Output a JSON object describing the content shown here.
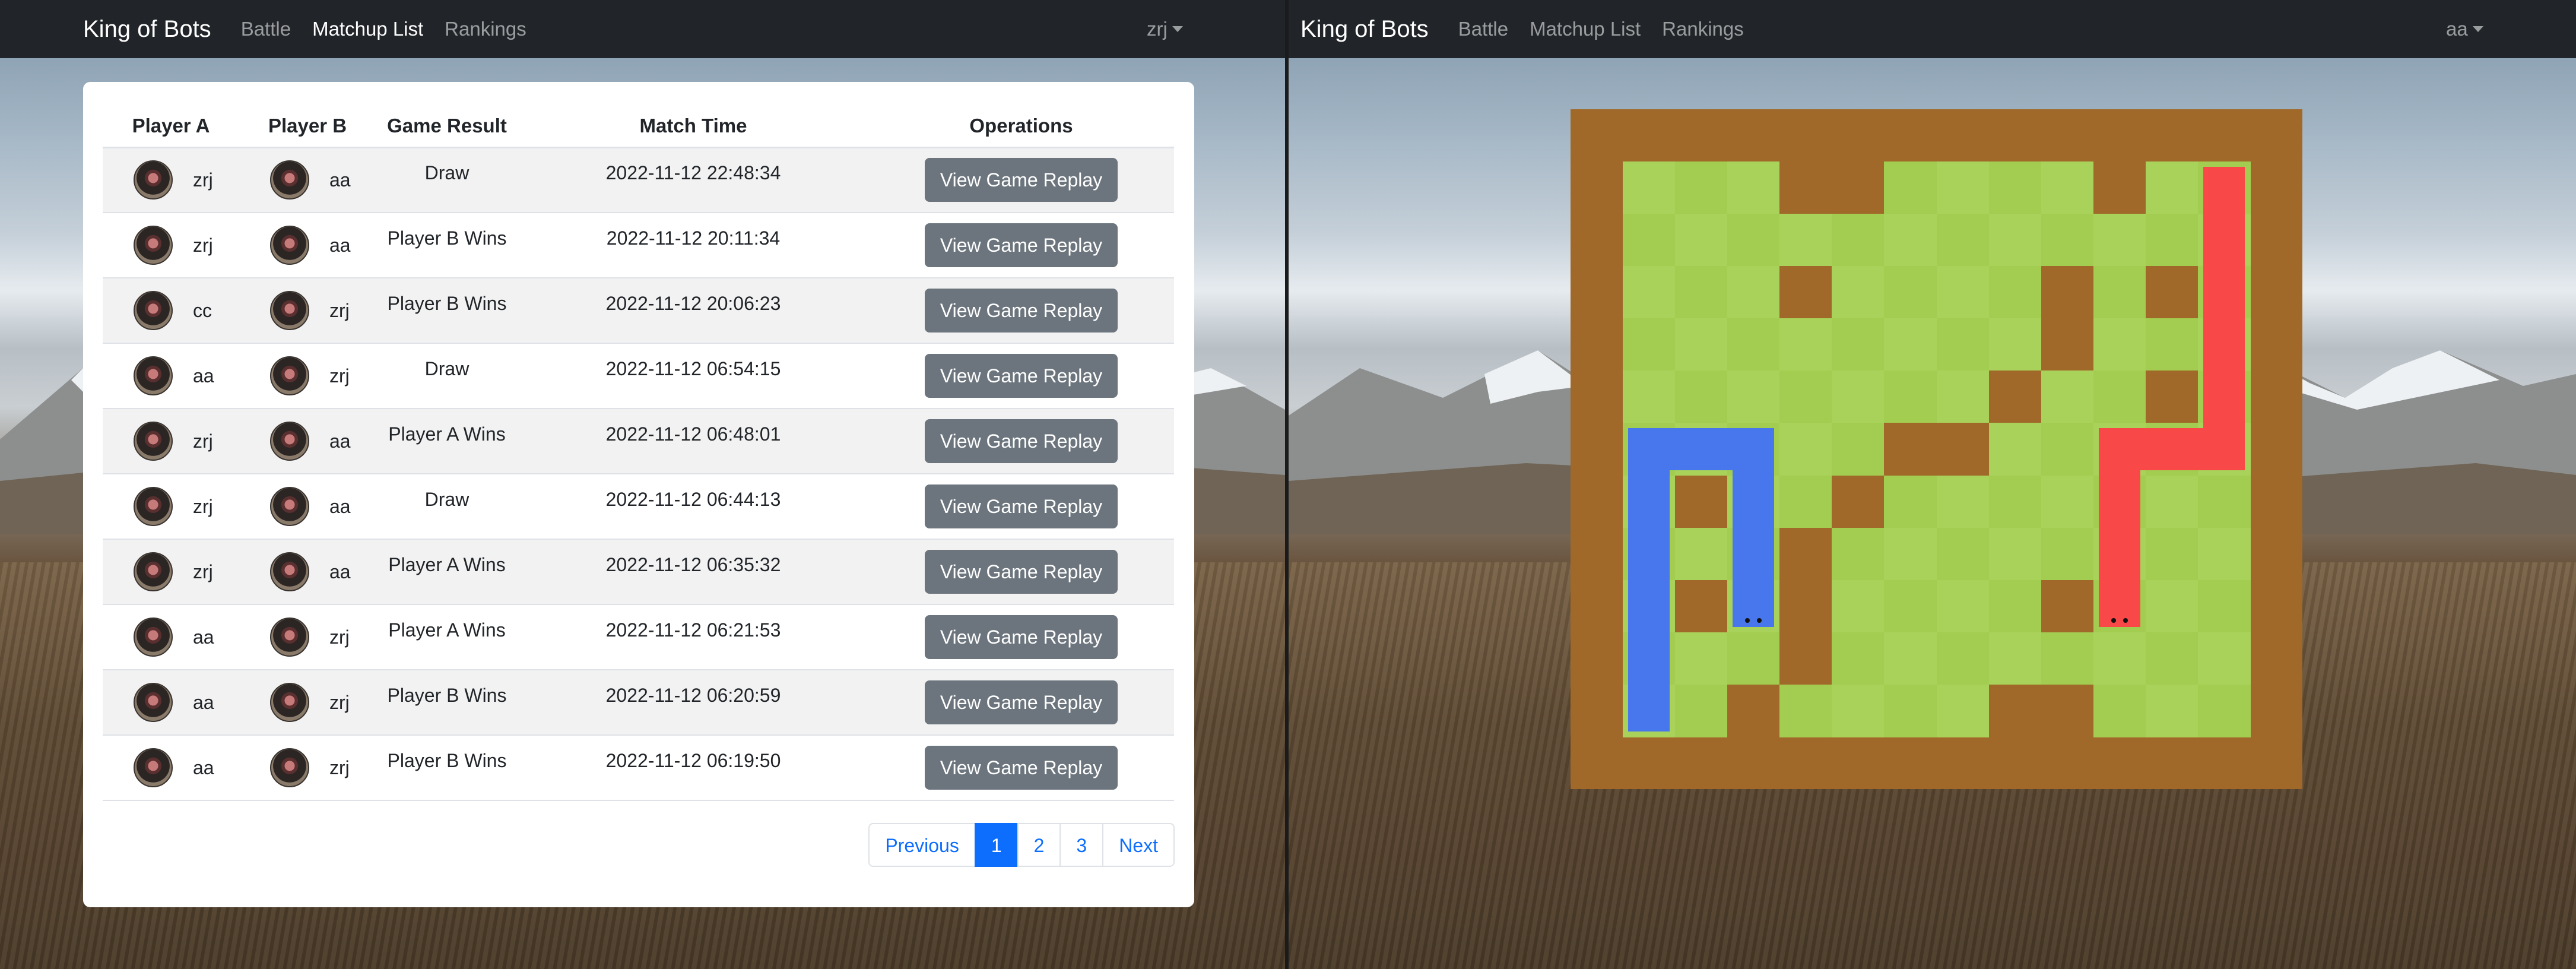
{
  "left_app": {
    "brand": "King of Bots",
    "nav": [
      "Battle",
      "Matchup List",
      "Rankings"
    ],
    "active_nav": "Matchup List",
    "user": "zrj",
    "table": {
      "headers": [
        "Player A",
        "Player B",
        "Game Result",
        "Match Time",
        "Operations"
      ],
      "rows": [
        {
          "a": "zrj",
          "b": "aa",
          "result": "Draw",
          "time": "2022-11-12 22:48:34"
        },
        {
          "a": "zrj",
          "b": "aa",
          "result": "Player B Wins",
          "time": "2022-11-12 20:11:34"
        },
        {
          "a": "cc",
          "b": "zrj",
          "result": "Player B Wins",
          "time": "2022-11-12 20:06:23"
        },
        {
          "a": "aa",
          "b": "zrj",
          "result": "Draw",
          "time": "2022-11-12 06:54:15"
        },
        {
          "a": "zrj",
          "b": "aa",
          "result": "Player A Wins",
          "time": "2022-11-12 06:48:01"
        },
        {
          "a": "zrj",
          "b": "aa",
          "result": "Draw",
          "time": "2022-11-12 06:44:13"
        },
        {
          "a": "zrj",
          "b": "aa",
          "result": "Player A Wins",
          "time": "2022-11-12 06:35:32"
        },
        {
          "a": "aa",
          "b": "zrj",
          "result": "Player A Wins",
          "time": "2022-11-12 06:21:53"
        },
        {
          "a": "aa",
          "b": "zrj",
          "result": "Player B Wins",
          "time": "2022-11-12 06:20:59"
        },
        {
          "a": "aa",
          "b": "zrj",
          "result": "Player B Wins",
          "time": "2022-11-12 06:19:50"
        }
      ],
      "action_label": "View Game Replay"
    },
    "pagination": {
      "previous": "Previous",
      "pages": [
        "1",
        "2",
        "3"
      ],
      "active_page": "1",
      "next": "Next"
    }
  },
  "right_app": {
    "brand": "King of Bots",
    "nav": [
      "Battle",
      "Matchup List",
      "Rankings"
    ],
    "user": "aa",
    "game": {
      "rows": 13,
      "cols": 14,
      "walls": [
        [
          0,
          0
        ],
        [
          0,
          1
        ],
        [
          0,
          2
        ],
        [
          0,
          3
        ],
        [
          0,
          4
        ],
        [
          0,
          5
        ],
        [
          0,
          6
        ],
        [
          0,
          7
        ],
        [
          0,
          8
        ],
        [
          0,
          9
        ],
        [
          0,
          10
        ],
        [
          0,
          11
        ],
        [
          0,
          12
        ],
        [
          0,
          13
        ],
        [
          12,
          0
        ],
        [
          12,
          1
        ],
        [
          12,
          2
        ],
        [
          12,
          3
        ],
        [
          12,
          4
        ],
        [
          12,
          5
        ],
        [
          12,
          6
        ],
        [
          12,
          7
        ],
        [
          12,
          8
        ],
        [
          12,
          9
        ],
        [
          12,
          10
        ],
        [
          12,
          11
        ],
        [
          12,
          12
        ],
        [
          12,
          13
        ],
        [
          1,
          0
        ],
        [
          2,
          0
        ],
        [
          3,
          0
        ],
        [
          4,
          0
        ],
        [
          5,
          0
        ],
        [
          6,
          0
        ],
        [
          7,
          0
        ],
        [
          8,
          0
        ],
        [
          9,
          0
        ],
        [
          10,
          0
        ],
        [
          11,
          0
        ],
        [
          1,
          13
        ],
        [
          2,
          13
        ],
        [
          3,
          13
        ],
        [
          4,
          13
        ],
        [
          5,
          13
        ],
        [
          6,
          13
        ],
        [
          7,
          13
        ],
        [
          8,
          13
        ],
        [
          9,
          13
        ],
        [
          10,
          13
        ],
        [
          11,
          13
        ],
        [
          1,
          4
        ],
        [
          1,
          5
        ],
        [
          1,
          10
        ],
        [
          3,
          4
        ],
        [
          3,
          9
        ],
        [
          3,
          11
        ],
        [
          4,
          9
        ],
        [
          5,
          8
        ],
        [
          5,
          11
        ],
        [
          6,
          6
        ],
        [
          6,
          7
        ],
        [
          7,
          2
        ],
        [
          7,
          5
        ],
        [
          8,
          4
        ],
        [
          9,
          4
        ],
        [
          9,
          2
        ],
        [
          9,
          9
        ],
        [
          10,
          4
        ],
        [
          11,
          3
        ],
        [
          11,
          8
        ],
        [
          11,
          9
        ]
      ],
      "snake_colors": {
        "blue": "#4876ec",
        "red": "#f94848"
      },
      "blue_snake": [
        [
          11,
          1
        ],
        [
          10,
          1
        ],
        [
          9,
          1
        ],
        [
          8,
          1
        ],
        [
          7,
          1
        ],
        [
          6,
          1
        ],
        [
          6,
          2
        ],
        [
          6,
          3
        ],
        [
          7,
          3
        ],
        [
          8,
          3
        ],
        [
          9,
          3
        ]
      ],
      "red_snake": [
        [
          1,
          12
        ],
        [
          2,
          12
        ],
        [
          3,
          12
        ],
        [
          4,
          12
        ],
        [
          5,
          12
        ],
        [
          6,
          12
        ],
        [
          6,
          11
        ],
        [
          6,
          10
        ],
        [
          7,
          10
        ],
        [
          8,
          10
        ],
        [
          9,
          10
        ]
      ]
    }
  }
}
